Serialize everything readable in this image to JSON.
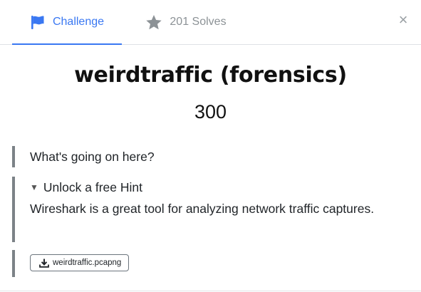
{
  "tabs": {
    "challenge": {
      "label": "Challenge",
      "icon": "flag-icon",
      "color": "#3a78f2"
    },
    "solves": {
      "label": "201 Solves",
      "icon": "star-icon",
      "color": "#8c9296"
    },
    "close": {
      "label": "×"
    }
  },
  "challenge": {
    "title": "weirdtraffic (forensics)",
    "points": "300",
    "description": "What's going on here?",
    "hint": {
      "toggle_label": "Unlock a free Hint",
      "text": "Wireshark is a great tool for analyzing network traffic captures."
    },
    "file": {
      "name": "weirdtraffic.pcapng",
      "icon": "download-icon"
    }
  }
}
